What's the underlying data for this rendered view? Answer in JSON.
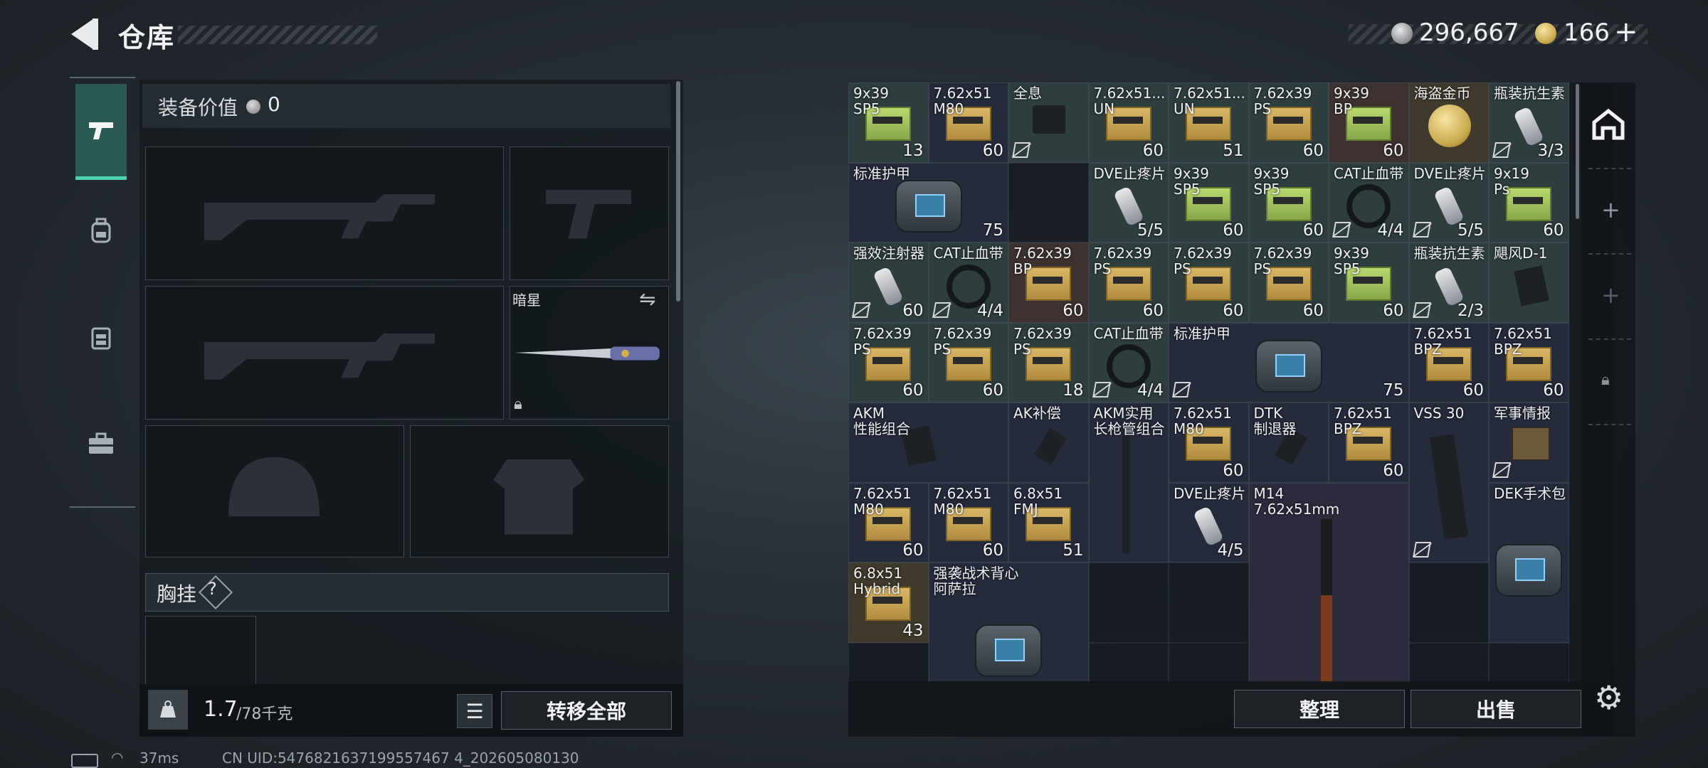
{
  "header": {
    "title": "仓库",
    "silver": "296,667",
    "gold": "166",
    "gold_plus": "+"
  },
  "tabs": [
    {
      "name": "weapons",
      "icon": "pistol-icon",
      "active": true
    },
    {
      "name": "backpack",
      "icon": "backpack-icon",
      "active": false
    },
    {
      "name": "vest",
      "icon": "vest-icon",
      "active": false
    },
    {
      "name": "case",
      "icon": "briefcase-icon",
      "active": false
    }
  ],
  "equipment": {
    "value_label": "装备价值",
    "value": "0",
    "melee_name": "暗星",
    "chest_label": "胸挂",
    "chest_help": "?",
    "weight": "1.7",
    "weight_cap": "/78千克",
    "transfer_all": "转移全部"
  },
  "inventory": {
    "items": [
      {
        "name": "9x39\nSP5",
        "count": "13",
        "kind": "box-green"
      },
      {
        "name": "7.62x51\nM80",
        "count": "60",
        "kind": "box"
      },
      {
        "name": "全息",
        "count": "",
        "kind": "sight",
        "no_cat": true
      },
      {
        "name": "7.62x51...\nUN",
        "count": "60",
        "kind": "box"
      },
      {
        "name": "7.62x51...\nUN",
        "count": "51",
        "kind": "box"
      },
      {
        "name": "7.62x39\nPS",
        "count": "60",
        "kind": "box"
      },
      {
        "name": "9x39\nBP",
        "count": "60",
        "kind": "box-green"
      },
      {
        "name": "海盗金币",
        "count": "",
        "kind": "coin"
      },
      {
        "name": "瓶装抗生素",
        "count": "3/3",
        "kind": "vial",
        "no_cat": true
      },
      {
        "name": "标准护甲",
        "count": "75",
        "kind": "armor"
      },
      {
        "name": "DVE止疼片",
        "count": "5/5",
        "kind": "vial"
      },
      {
        "name": "9x39\nSP5",
        "count": "60",
        "kind": "box-green"
      },
      {
        "name": "9x39\nSP5",
        "count": "60",
        "kind": "box-green"
      },
      {
        "name": "CAT止血带",
        "count": "4/4",
        "kind": "band",
        "no_cat": true
      },
      {
        "name": "DVE止疼片",
        "count": "5/5",
        "kind": "vial",
        "no_cat": true
      },
      {
        "name": "9x19\nPs",
        "count": "60",
        "kind": "box-green"
      },
      {
        "name": "强效注射器",
        "count": "60",
        "kind": "syringe",
        "no_cat": true
      },
      {
        "name": "CAT止血带",
        "count": "4/4",
        "kind": "band",
        "no_cat": true
      },
      {
        "name": "7.62x39\nBP",
        "count": "60",
        "kind": "box"
      },
      {
        "name": "7.62x39\nPS",
        "count": "60",
        "kind": "box"
      },
      {
        "name": "7.62x39\nPS",
        "count": "60",
        "kind": "box"
      },
      {
        "name": "7.62x39\nPS",
        "count": "60",
        "kind": "box"
      },
      {
        "name": "9x39\nSP5",
        "count": "60",
        "kind": "box-green"
      },
      {
        "name": "瓶装抗生素",
        "count": "2/3",
        "kind": "vial",
        "no_cat": true
      },
      {
        "name": "飓风D-1",
        "count": "",
        "kind": "grip"
      },
      {
        "name": "7.62x39\nPS",
        "count": "60",
        "kind": "box"
      },
      {
        "name": "7.62x39\nPS",
        "count": "60",
        "kind": "box"
      },
      {
        "name": "7.62x39\nPS",
        "count": "18",
        "kind": "box"
      },
      {
        "name": "CAT止血带",
        "count": "4/4",
        "kind": "band",
        "no_cat": true
      },
      {
        "name": "标准护甲",
        "count": "75",
        "kind": "armor",
        "no_cat": true
      },
      {
        "name": "7.62x51\nBPZ",
        "count": "60",
        "kind": "box"
      },
      {
        "name": "7.62x51\nBPZ",
        "count": "60",
        "kind": "box"
      },
      {
        "name": "AKM\n性能组合",
        "count": "",
        "kind": "grip"
      },
      {
        "name": "AK补偿",
        "count": "",
        "kind": "muzzle"
      },
      {
        "name": "AKM实用\n长枪管组合",
        "count": "",
        "kind": "barrel"
      },
      {
        "name": "7.62x51\nM80",
        "count": "60",
        "kind": "box"
      },
      {
        "name": "DTK\n制退器",
        "count": "",
        "kind": "muzzle"
      },
      {
        "name": "7.62x51\nBPZ",
        "count": "60",
        "kind": "box"
      },
      {
        "name": "VSS 30",
        "count": "",
        "kind": "mag",
        "no_cat": true
      },
      {
        "name": "军事情报",
        "count": "",
        "kind": "intel",
        "no_cat": true
      },
      {
        "name": "7.62x51\nM80",
        "count": "60",
        "kind": "box"
      },
      {
        "name": "7.62x51\nM80",
        "count": "60",
        "kind": "box"
      },
      {
        "name": "6.8x51\nFMJ",
        "count": "51",
        "kind": "box"
      },
      {
        "name": "DVE止疼片",
        "count": "4/5",
        "kind": "vial"
      },
      {
        "name": "M14\n7.62x51mm",
        "count": "",
        "kind": "rifle"
      },
      {
        "name": "DEK手术包",
        "count": "",
        "kind": "medkit"
      },
      {
        "name": "6.8x51\nHybrid",
        "count": "43",
        "kind": "box"
      },
      {
        "name": "强袭战术背心\n阿萨拉",
        "count": "",
        "kind": "vestbag"
      }
    ],
    "sort_label": "整理",
    "sell_label": "出售"
  },
  "status": {
    "ping": "37ms",
    "uid": "CN UID:5476821637199557467 4_202605080130"
  }
}
